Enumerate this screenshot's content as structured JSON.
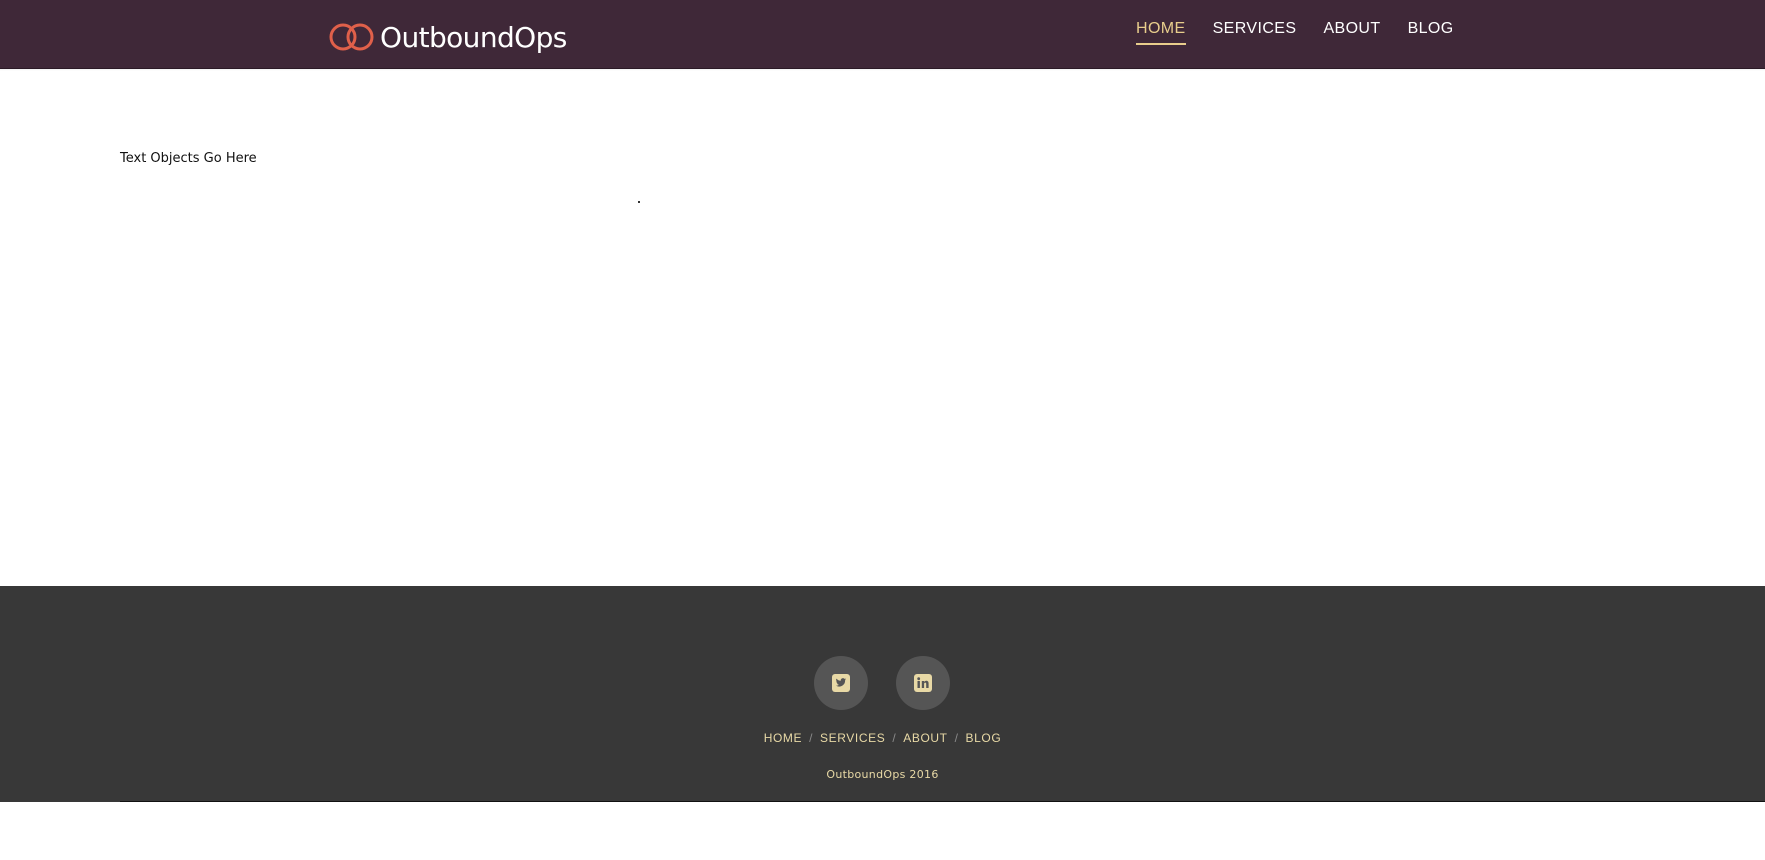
{
  "brand": {
    "name": "OutboundOps",
    "icon": "double-ring-logo",
    "accent_color": "#e0604a"
  },
  "header": {
    "bg_color": "#3f2838",
    "nav": [
      {
        "label": "HOME",
        "active": true
      },
      {
        "label": "SERVICES",
        "active": false
      },
      {
        "label": "ABOUT",
        "active": false
      },
      {
        "label": "BLOG",
        "active": false
      }
    ],
    "active_color": "#e8cd8c"
  },
  "main": {
    "text": "Text Objects Go Here",
    "stray_char": "."
  },
  "footer": {
    "bg_color": "#383838",
    "social": [
      {
        "icon": "twitter-icon"
      },
      {
        "icon": "linkedin-icon"
      }
    ],
    "nav": [
      {
        "label": "HOME"
      },
      {
        "label": "SERVICES"
      },
      {
        "label": "ABOUT"
      },
      {
        "label": "BLOG"
      }
    ],
    "separator": "/",
    "copyright": "OutboundOps 2016"
  }
}
